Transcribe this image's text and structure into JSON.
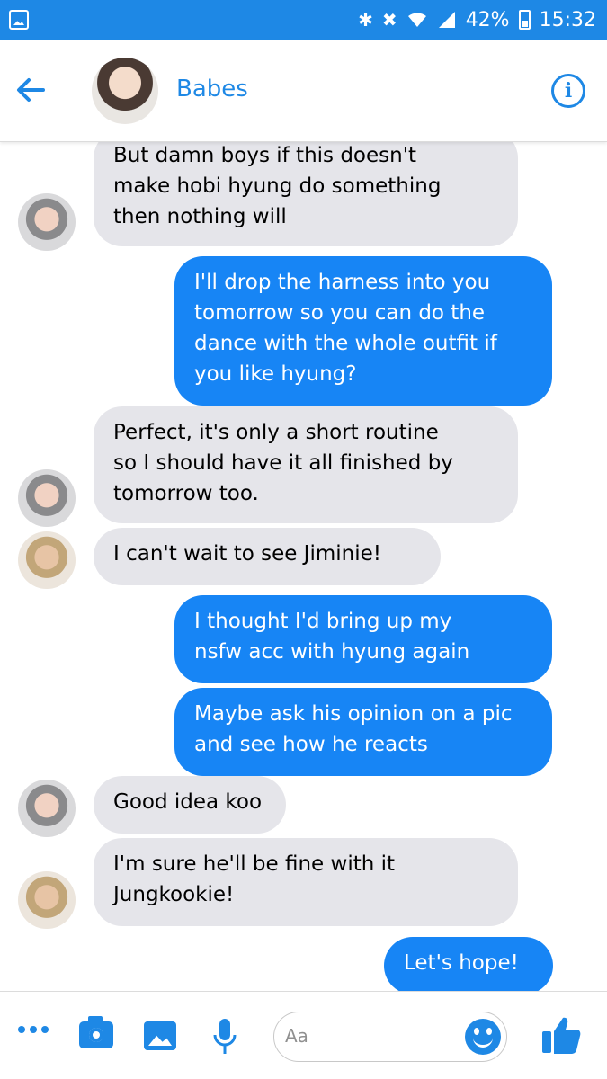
{
  "status_bar": {
    "battery": "42%",
    "time": "15:32",
    "icons": [
      "gallery-icon",
      "bluetooth-icon",
      "mute-icon",
      "wifi-icon",
      "signal-icon",
      "battery-icon"
    ]
  },
  "header": {
    "contact_name": "Babes",
    "icons": [
      "back-arrow-icon",
      "info-icon"
    ]
  },
  "messages": [
    {
      "side": "in",
      "sender": "jimin",
      "text": "But damn boys if this doesn't\nmake hobi hyung do something\nthen nothing will"
    },
    {
      "side": "out",
      "text": "I'll drop the harness into you\ntomorrow so you can do the\ndance with the whole outfit if\nyou like hyung?"
    },
    {
      "side": "in",
      "sender": "jimin",
      "text": "Perfect, it's only a short routine\nso I should have it all finished by\ntomorrow too."
    },
    {
      "side": "in",
      "sender": "tae",
      "text": "I can't wait to see Jiminie!"
    },
    {
      "side": "out",
      "text": "I thought I'd bring up my\nnsfw acc with hyung again"
    },
    {
      "side": "out",
      "text": "Maybe ask his opinion on a pic\nand see how he reacts"
    },
    {
      "side": "in",
      "sender": "jimin",
      "text": "Good idea koo"
    },
    {
      "side": "in",
      "sender": "tae",
      "text": "I'm sure he'll be fine with it\nJungkookie!"
    },
    {
      "side": "out",
      "text": "Let's hope!"
    }
  ],
  "composer": {
    "placeholder": "Aa",
    "icons": [
      "more-icon",
      "camera-icon",
      "image-icon",
      "microphone-icon",
      "emoji-icon",
      "thumbs-up-icon"
    ]
  },
  "colors": {
    "brand_blue": "#1e88e5",
    "outgoing_bubble": "#1785f5",
    "incoming_bubble": "#e5e5ea"
  }
}
